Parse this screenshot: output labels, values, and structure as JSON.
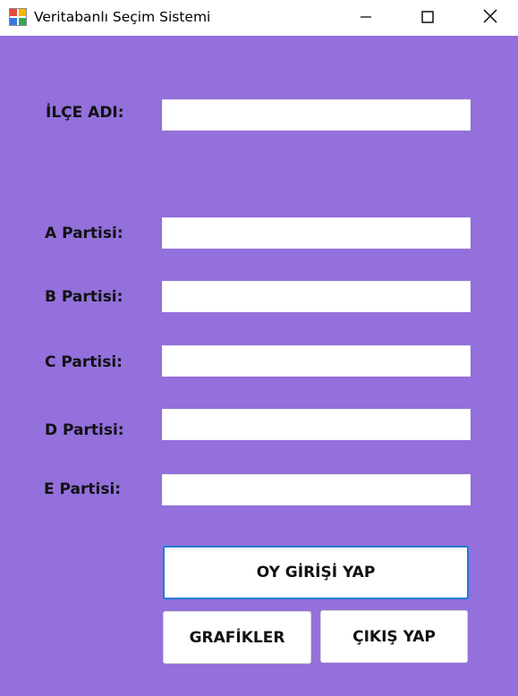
{
  "window": {
    "title": "Veritabanlı Seçim Sistemi",
    "app_icon": "windows-forms-app-icon",
    "controls": [
      "minimize-icon",
      "maximize-icon",
      "close-icon"
    ]
  },
  "form": {
    "background_color": "#9370DB",
    "district": {
      "label": "İLÇE ADI:",
      "value": ""
    },
    "parties": [
      {
        "label": "A Partisi:",
        "value": ""
      },
      {
        "label": "B Partisi:",
        "value": ""
      },
      {
        "label": "C Partisi:",
        "value": ""
      },
      {
        "label": "D Partisi:",
        "value": ""
      },
      {
        "label": "E Partisi:",
        "value": ""
      }
    ]
  },
  "buttons": {
    "submit_vote": "OY GİRİŞİ YAP",
    "charts": "GRAFİKLER",
    "exit": "ÇIKIŞ YAP",
    "focus_color": "#1E7AD6"
  }
}
